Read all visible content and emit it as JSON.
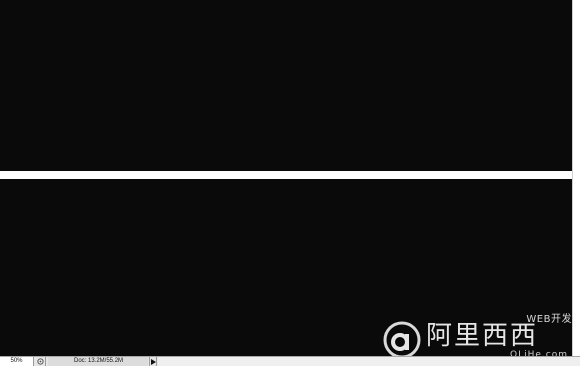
{
  "document": {
    "panel_color": "#0a0a0a",
    "stripe_color": "#ffffff"
  },
  "watermark": {
    "top_text": "WEB开发",
    "main_text": "阿里西西",
    "sub_text": "OLiHe.com"
  },
  "status_bar": {
    "zoom": "50%",
    "doc_info": "Doc: 13.2M/55.2M",
    "status_icon": "document-status-icon",
    "menu_arrow_icon": "play-right-icon"
  }
}
